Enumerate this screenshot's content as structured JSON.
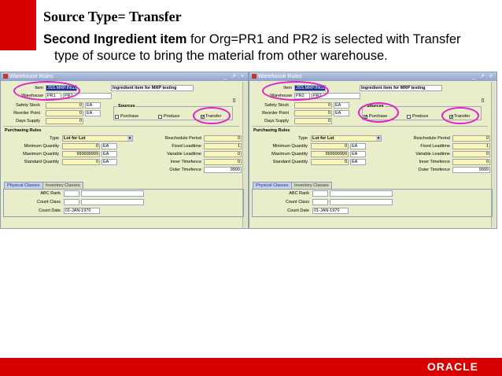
{
  "slide": {
    "title": "Source Type= Transfer",
    "desc_bold": "Second Ingredient item",
    "desc_rest": " for Org=PR1 and PR2 is selected with Transfer",
    "desc_line2": "type of source to bring the material from other warehouse."
  },
  "colors": {
    "brand_red": "#d80000",
    "highlight_oval": "#e020c8",
    "required_field": "#fbf7b3"
  },
  "windows": [
    {
      "title": "Warehouse Rules",
      "controls": "_ ↗ ×",
      "item_label": "Item",
      "item_value": "JSS.MRP.ING2",
      "item_desc": "Ingredient item for MRP testing",
      "warehouse_label": "Warehouse",
      "warehouse_code": "PR1",
      "warehouse_name": "PR1",
      "safety_stock_label": "Safety Stock",
      "safety_stock_value": "0",
      "safety_stock_uom": "EA",
      "reorder_point_label": "Reorder Point",
      "reorder_point_value": "0",
      "reorder_point_uom": "EA",
      "days_supply_label": "Days Supply",
      "days_supply_value": "0",
      "sources_label": "Sources",
      "purchase_label": "Purchase",
      "purchase_mark": "",
      "produce_label": "Produce",
      "produce_mark": "",
      "transfer_label": "Transfer",
      "transfer_mark": "✔",
      "purchasing_rules_label": "Purchasing Rules",
      "type_label": "Type",
      "type_value": "Lot for Lot",
      "min_qty_label": "Minimum Quantity",
      "min_qty_value": "0",
      "min_qty_uom": "EA",
      "max_qty_label": "Maximum Quantity",
      "max_qty_value": "999999999",
      "max_qty_uom": "EA",
      "std_qty_label": "Standard Quantity",
      "std_qty_value": "0",
      "std_qty_uom": "EA",
      "resched_label": "Reschedule Period",
      "resched_value": "0",
      "fixed_lead_label": "Fixed Leadtime",
      "fixed_lead_value": "1",
      "var_lead_label": "Variable Leadtime",
      "var_lead_value": "0",
      "inner_tf_label": "Inner Timefence",
      "inner_tf_value": "0",
      "outer_tf_label": "Outer Timefence",
      "outer_tf_value": "9999",
      "tab_physical": "Physical Classes",
      "tab_inventory": "Inventory Classes",
      "abc_label": "ABC Rank",
      "abc_value": "",
      "count_class_label": "Count Class",
      "count_class_value": "",
      "count_date_label": "Count Date",
      "count_date_value": "01-JAN-1970"
    },
    {
      "title": "Warehouse Rules",
      "controls": "_ ↗ ×",
      "item_label": "Item",
      "item_value": "JSS.MRP.ING2",
      "item_desc": "Ingredient item for MRP testing",
      "warehouse_label": "Warehouse",
      "warehouse_code": "PR2",
      "warehouse_name": "PR2",
      "safety_stock_label": "Safety Stock",
      "safety_stock_value": "0",
      "safety_stock_uom": "EA",
      "reorder_point_label": "Reorder Point",
      "reorder_point_value": "0",
      "reorder_point_uom": "EA",
      "days_supply_label": "Days Supply",
      "days_supply_value": "0",
      "sources_label": "Sources",
      "purchase_label": "Purchase",
      "purchase_mark": "✔",
      "produce_label": "Produce",
      "produce_mark": "",
      "transfer_label": "Transfer",
      "transfer_mark": "✔",
      "purchasing_rules_label": "Purchasing Rules",
      "type_label": "Type",
      "type_value": "Lot for Lot",
      "min_qty_label": "Minimum Quantity",
      "min_qty_value": "0",
      "min_qty_uom": "EA",
      "max_qty_label": "Maximum Quantity",
      "max_qty_value": "999999999",
      "max_qty_uom": "EA",
      "std_qty_label": "Standard Quantity",
      "std_qty_value": "0",
      "std_qty_uom": "EA",
      "resched_label": "Reschedule Period",
      "resched_value": "0",
      "fixed_lead_label": "Fixed Leadtime",
      "fixed_lead_value": "1",
      "var_lead_label": "Variable Leadtime",
      "var_lead_value": "0",
      "inner_tf_label": "Inner Timefence",
      "inner_tf_value": "0",
      "outer_tf_label": "Outer Timefence",
      "outer_tf_value": "9999",
      "tab_physical": "Physical Classes",
      "tab_inventory": "Inventory Classes",
      "abc_label": "ABC Rank",
      "abc_value": "",
      "count_class_label": "Count Class",
      "count_class_value": "",
      "count_date_label": "Count Date",
      "count_date_value": "01-JAN-1970"
    }
  ],
  "footer": {
    "logo_text": "ORACLE"
  }
}
